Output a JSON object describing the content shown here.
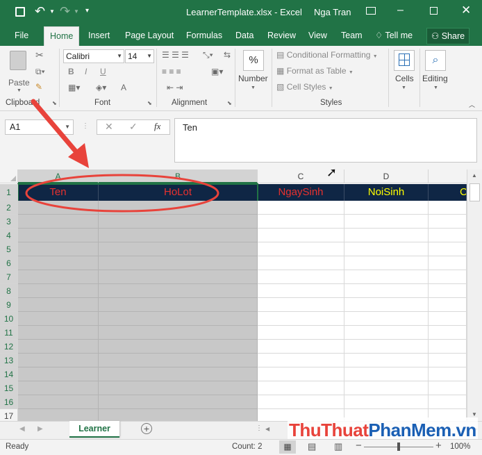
{
  "titlebar": {
    "filename": "LearnerTemplate.xlsx",
    "separator": " - ",
    "app": "Excel",
    "user": "Nga Tran"
  },
  "tabs": [
    "File",
    "Home",
    "Insert",
    "Page Layout",
    "Formulas",
    "Data",
    "Review",
    "View",
    "Team"
  ],
  "tell_me": "Tell me",
  "share": "Share",
  "ribbon": {
    "clipboard": {
      "paste": "Paste",
      "label": "Clipboard"
    },
    "font": {
      "name": "Calibri",
      "size": "14",
      "label": "Font",
      "bold": "B",
      "italic": "I",
      "underline": "U",
      "fontcolor": "A"
    },
    "alignment": {
      "label": "Alignment"
    },
    "number": {
      "label": "Number",
      "symbol": "%"
    },
    "styles": {
      "conditional": "Conditional Formatting",
      "table": "Format as Table",
      "cellstyles": "Cell Styles",
      "label": "Styles"
    },
    "cells": {
      "label": "Cells"
    },
    "editing": {
      "label": "Editing"
    }
  },
  "formula": {
    "namebox": "A1",
    "fx": "fx",
    "value": "Ten"
  },
  "columns": [
    "A",
    "B",
    "C",
    "D"
  ],
  "rows": [
    "1",
    "2",
    "3",
    "4",
    "5",
    "6",
    "7",
    "8",
    "9",
    "10",
    "11",
    "12",
    "13",
    "14",
    "15",
    "16",
    "17"
  ],
  "headers": {
    "a": "Ten",
    "b": "HoLot",
    "c": "NgaySinh",
    "d": "NoiSinh",
    "e": "C"
  },
  "header_colors": {
    "red": "#e8312f",
    "yellow": "#ffff00",
    "bg": "#0f2645"
  },
  "sheet": {
    "name": "Learner"
  },
  "status": {
    "ready": "Ready",
    "count": "Count: 2",
    "zoom": "100%"
  },
  "watermark": {
    "p1": "Thu",
    "p2": "Thuat",
    "p3": "Phan",
    "p4": "Mem",
    "p5": ".vn"
  },
  "colors": {
    "excel_green": "#217346",
    "selection": "#217346",
    "annotation": "#e8433b"
  }
}
